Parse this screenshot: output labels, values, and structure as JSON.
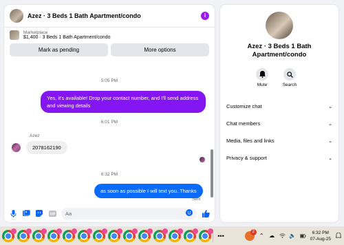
{
  "header": {
    "title": "Azez · 3 Beds 1 Bath Apartment/condo",
    "info_glyph": "i"
  },
  "marketplace": {
    "label": "Marketplace",
    "listing": "$1,400 · 3 Beds 1 Bath Apartment/condo",
    "pending_label": "Mark as pending",
    "options_label": "More options"
  },
  "messages": {
    "ts1": "5:05 PM",
    "out1": "Yes, it's available! Drop your contact number, and I'll send address and viewing details",
    "ts2": "6:01 PM",
    "sender": "Azez",
    "in1": "2078162190",
    "ts3": "6:32 PM",
    "out2": "as soon as possible I will text you..Thanks",
    "status": "Sent"
  },
  "composer": {
    "placeholder": "Aa"
  },
  "info_panel": {
    "title": "Azez · 3 Beds 1 Bath Apartment/condo",
    "mute_label": "Mute",
    "search_label": "Search",
    "sections": [
      "Customize chat",
      "Chat members",
      "Media, files and links",
      "Privacy & support"
    ]
  },
  "taskbar": {
    "app_count": 14,
    "notification_badge": "2",
    "time": "6:32 PM",
    "date": "07-Aug-25"
  },
  "colors": {
    "accent": "#0866ff",
    "outgoing_bubble": "#8316f2",
    "info_icon": "#9b1cf0"
  }
}
